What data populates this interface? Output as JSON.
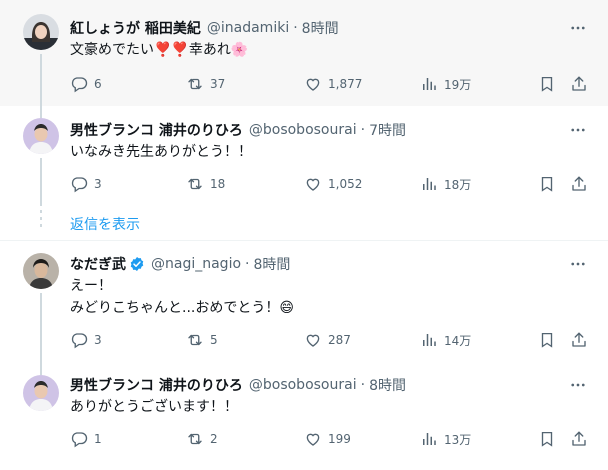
{
  "colors": {
    "accent": "#1d9bf0",
    "text": "#0f1419",
    "muted": "#536471"
  },
  "tweets": [
    {
      "name": "紅しょうが 稲田美紀",
      "handle": "@inadamiki",
      "sep": "·",
      "time": "8時間",
      "text": "文豪めでたい❣️❣️幸あれ🌸",
      "replies": "6",
      "retweets": "37",
      "likes": "1,877",
      "views": "19万"
    },
    {
      "name": "男性ブランコ 浦井のりひろ",
      "handle": "@bosobosourai",
      "sep": "·",
      "time": "7時間",
      "text": "いなみき先生ありがとう！！",
      "replies": "3",
      "retweets": "18",
      "likes": "1,052",
      "views": "18万"
    },
    {
      "name": "なだぎ武",
      "handle": "@nagi_nagio",
      "sep": "·",
      "time": "8時間",
      "text_line1": "えー！",
      "text_line2": "みどりこちゃんと...おめでとう！😄",
      "replies": "3",
      "retweets": "5",
      "likes": "287",
      "views": "14万"
    },
    {
      "name": "男性ブランコ 浦井のりひろ",
      "handle": "@bosobosourai",
      "sep": "·",
      "time": "8時間",
      "text": "ありがとうございます！！",
      "replies": "1",
      "retweets": "2",
      "likes": "199",
      "views": "13万"
    }
  ],
  "show_replies_label": "返信を表示",
  "icons": [
    "reply-icon",
    "retweet-icon",
    "like-icon",
    "views-icon",
    "bookmark-icon",
    "share-icon",
    "more-icon",
    "verified-icon"
  ]
}
